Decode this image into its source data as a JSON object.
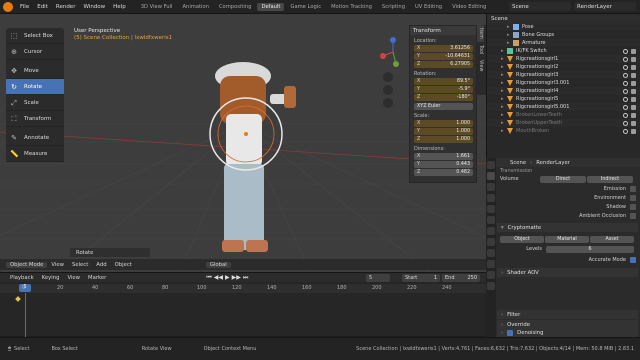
{
  "menus": [
    "File",
    "Edit",
    "Render",
    "Window",
    "Help"
  ],
  "workspaces": [
    "3D View Full",
    "Animation",
    "Compositing",
    "Default",
    "Game Logic",
    "Motion Tracking",
    "Scripting",
    "UV Editing",
    "Video Editing"
  ],
  "active_workspace": "Default",
  "scene_name": "Scene",
  "render_layer": "RenderLayer",
  "viewport": {
    "title": "User Perspective",
    "subtitle": "(5) Scene Collection | lxwldfxweris1"
  },
  "tools": [
    "Select Box",
    "Cursor",
    "Move",
    "Rotate",
    "Scale",
    "Transform",
    "Annotate",
    "Measure"
  ],
  "active_tool": "Rotate",
  "transform_panel": {
    "title": "Transform",
    "location_label": "Location:",
    "location": [
      {
        "k": "X",
        "v": "3.61256"
      },
      {
        "k": "Y",
        "v": "-10.64631"
      },
      {
        "k": "Z",
        "v": "6.27905"
      }
    ],
    "rotation_label": "Rotation:",
    "rotation": [
      {
        "k": "X",
        "v": "89.5°"
      },
      {
        "k": "Y",
        "v": "-5.9°"
      },
      {
        "k": "Z",
        "v": "-180°"
      }
    ],
    "rotation_mode": "XYZ Euler",
    "scale_label": "Scale:",
    "scale": [
      {
        "k": "X",
        "v": "1.000"
      },
      {
        "k": "Y",
        "v": "1.000"
      },
      {
        "k": "Z",
        "v": "1.000"
      }
    ],
    "dimensions_label": "Dimensions:",
    "dimensions": [
      {
        "k": "X",
        "v": "1.661"
      },
      {
        "k": "Y",
        "v": "0.443"
      },
      {
        "k": "Z",
        "v": "0.482"
      }
    ]
  },
  "side_tabs": [
    "Item",
    "Tool",
    "View"
  ],
  "viewport_header": [
    "Object Mode",
    "View",
    "Select",
    "Add",
    "Object",
    "Global"
  ],
  "last_operator": "Rotate",
  "timeline": {
    "header": [
      "Playback",
      "Keying",
      "View",
      "Marker"
    ],
    "current_frame": "5",
    "start_label": "Start",
    "start": "1",
    "end_label": "End",
    "end": "250",
    "ruler": [
      "0",
      "20",
      "40",
      "60",
      "80",
      "100",
      "120",
      "140",
      "160",
      "180",
      "200",
      "220",
      "240"
    ]
  },
  "outliner": {
    "header": "Scene",
    "items": [
      {
        "name": "Pose",
        "sel": false
      },
      {
        "name": "Bone Groups",
        "sel": false
      },
      {
        "name": "Armature",
        "sel": false
      },
      {
        "name": "IK/FK Switch",
        "sel": false
      },
      {
        "name": "Rigcreationsgirl1",
        "sel": false
      },
      {
        "name": "Rigcreationsgirl2",
        "sel": false
      },
      {
        "name": "Rigcreationsgirl3",
        "sel": false
      },
      {
        "name": "Rigcreationsgirl3.001",
        "sel": false
      },
      {
        "name": "Rigcreationsgirl4",
        "sel": false
      },
      {
        "name": "Rigcreationsgirl5",
        "sel": false
      },
      {
        "name": "Rigcreationsgirl5.001",
        "sel": false
      },
      {
        "name": "BrokenLowerTeeth",
        "sel": false
      },
      {
        "name": "BrokenUpperTeeth",
        "sel": false
      },
      {
        "name": "MouthBroken",
        "sel": false
      }
    ]
  },
  "properties": {
    "breadcrumb_scene": "Scene",
    "breadcrumb_layer": "RenderLayer",
    "transmission_label": "Transmission",
    "volume_label": "Volume",
    "volume_direct": "Direct",
    "volume_indirect": "Indirect",
    "checkboxes": [
      "Emission",
      "Environment",
      "Shadow",
      "Ambient Occlusion"
    ],
    "cryptomatte_title": "Cryptomatte",
    "crypto_buttons": [
      "Object",
      "Material",
      "Asset"
    ],
    "levels_label": "Levels",
    "levels": "6",
    "accurate_mode": "Accurate Mode",
    "shader_aov": "Shader AOV",
    "filter": "Filter",
    "override": "Override",
    "denoising": "Denoising"
  },
  "status": {
    "select": "Select",
    "box_select": "Box Select",
    "rotate_view": "Rotate View",
    "context_menu": "Object Context Menu",
    "stats": "Scene Collection | lxwldfxweris1 | Verts:4,761 | Faces:6,632 | Tris:7,632 | Objects:4/14 | Mem: 50.8 MiB | 2.83.1"
  },
  "colors": {
    "accent": "#4772b3",
    "orange": "#e87d0d",
    "viewport_bg": "#3d3d3d"
  }
}
